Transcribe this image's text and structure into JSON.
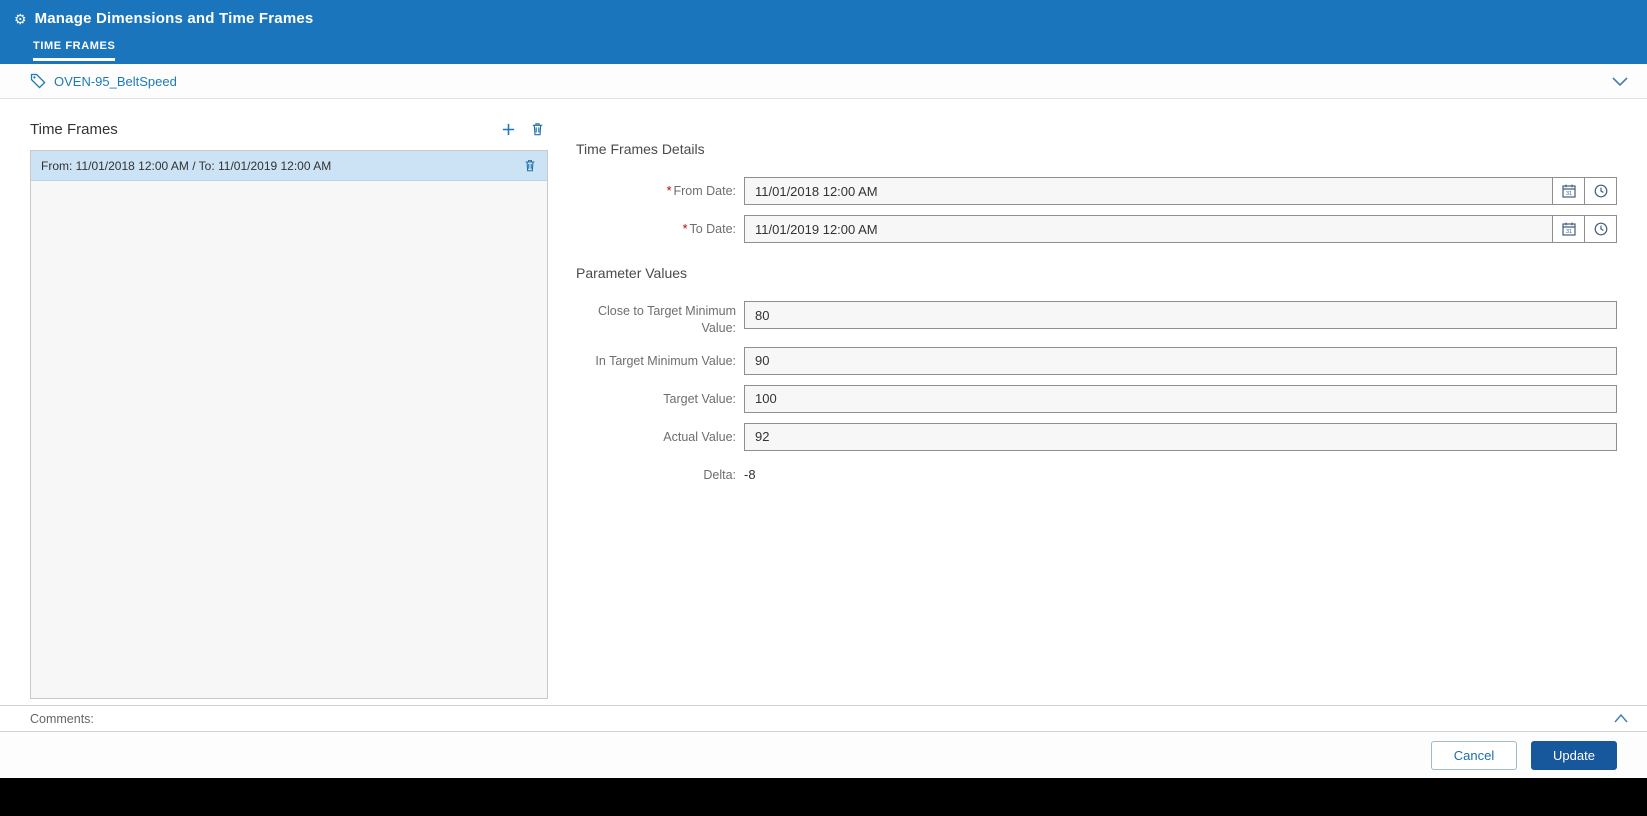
{
  "header": {
    "title": "Manage Dimensions and Time Frames",
    "tab_time_frames": "TIME FRAMES"
  },
  "icons": {
    "gear": "⚙"
  },
  "variable_bar": {
    "name": "OVEN-95_BeltSpeed"
  },
  "time_frames_panel": {
    "title": "Time Frames",
    "items": [
      {
        "label": "From: 11/01/2018 12:00 AM / To: 11/01/2019 12:00 AM"
      }
    ]
  },
  "details": {
    "title": "Time Frames Details",
    "required_marker": "*",
    "from_label": "From Date:",
    "from_value": "11/01/2018 12:00 AM",
    "to_label": "To Date:",
    "to_value": "11/01/2019 12:00 AM",
    "params_title": "Parameter Values",
    "fields": [
      {
        "label": "Close to Target Minimum Value:",
        "value": "80"
      },
      {
        "label": "In Target Minimum Value:",
        "value": "90"
      },
      {
        "label": "Target Value:",
        "value": "100"
      },
      {
        "label": "Actual Value:",
        "value": "92"
      }
    ],
    "delta_label": "Delta:",
    "delta_value": "-8"
  },
  "comments": {
    "label": "Comments:"
  },
  "footer": {
    "cancel_label": "Cancel",
    "update_label": "Update"
  },
  "colors": {
    "header_bg": "#1b75bc",
    "accent": "#1d7ab8",
    "selected_item_bg": "#cbe3f5",
    "update_button_bg": "#17579b",
    "required_marker": "#c00000"
  }
}
